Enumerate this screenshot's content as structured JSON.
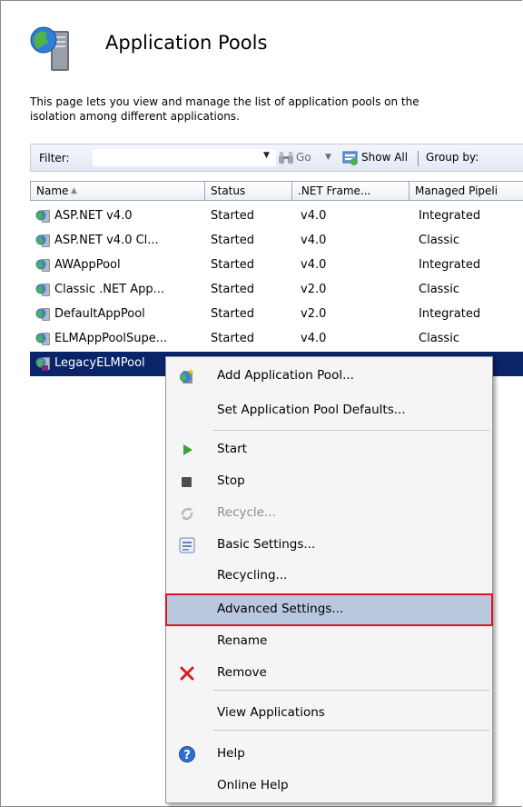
{
  "header": {
    "title": "Application Pools",
    "description_line1": "This page lets you view and manage the list of application pools on the",
    "description_line2": "isolation among different applications."
  },
  "toolbar": {
    "filter_label": "Filter:",
    "filter_value": "",
    "go_label": "Go",
    "show_all_label": "Show All",
    "group_by_label": "Group by:"
  },
  "grid": {
    "columns": [
      "Name",
      "Status",
      ".NET Frame...",
      "Managed Pipeli"
    ],
    "rows": [
      {
        "name": "ASP.NET v4.0",
        "status": "Started",
        "net": "v4.0",
        "pipeline": "Integrated"
      },
      {
        "name": "ASP.NET v4.0 Cl...",
        "status": "Started",
        "net": "v4.0",
        "pipeline": "Classic"
      },
      {
        "name": "AWAppPool",
        "status": "Started",
        "net": "v4.0",
        "pipeline": "Integrated"
      },
      {
        "name": "Classic .NET App...",
        "status": "Started",
        "net": "v2.0",
        "pipeline": "Classic"
      },
      {
        "name": "DefaultAppPool",
        "status": "Started",
        "net": "v2.0",
        "pipeline": "Integrated"
      },
      {
        "name": "ELMAppPoolSupe...",
        "status": "Started",
        "net": "v4.0",
        "pipeline": "Classic"
      },
      {
        "name": "LegacyELMPool",
        "status": "",
        "net": "",
        "pipeline": ""
      }
    ]
  },
  "context_menu": {
    "items": [
      {
        "label": "Add Application Pool...",
        "icon": "add-pool-icon"
      },
      {
        "label": "Set Application Pool Defaults...",
        "icon": ""
      },
      {
        "label": "Start",
        "icon": "play-icon"
      },
      {
        "label": "Stop",
        "icon": "stop-icon"
      },
      {
        "label": "Recycle...",
        "icon": "recycle-icon",
        "disabled": true
      },
      {
        "label": "Basic Settings...",
        "icon": "basic-settings-icon"
      },
      {
        "label": "Recycling...",
        "icon": ""
      },
      {
        "label": "Advanced Settings...",
        "icon": "",
        "highlighted": true
      },
      {
        "label": "Rename",
        "icon": ""
      },
      {
        "label": "Remove",
        "icon": "remove-icon"
      },
      {
        "label": "View Applications",
        "icon": ""
      },
      {
        "label": "Help",
        "icon": "help-icon"
      },
      {
        "label": "Online Help",
        "icon": ""
      }
    ]
  },
  "colors": {
    "selection": "#0a246a",
    "highlight": "#b9c8df",
    "highlight_border": "#e0141e",
    "start_green": "#3aa33a",
    "remove_red": "#d81e1e"
  }
}
